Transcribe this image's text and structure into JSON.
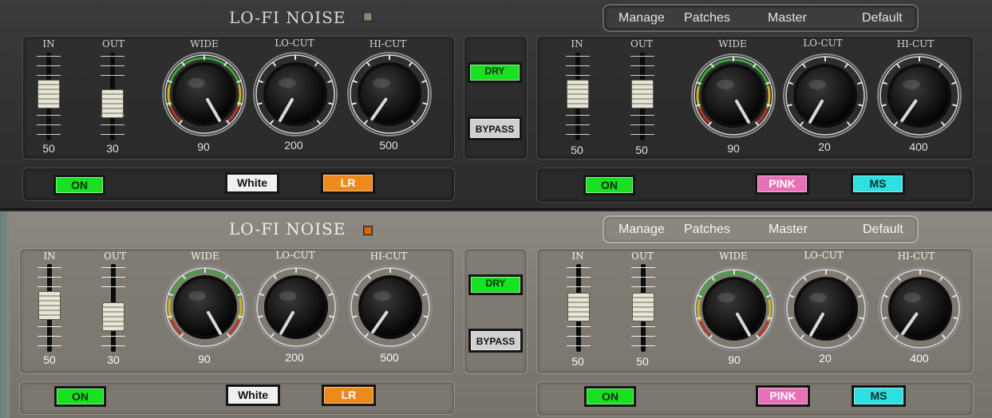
{
  "skins": [
    {
      "title": "LO-FI NOISE",
      "menu": [
        "Manage",
        "Patches",
        "Master",
        "Default"
      ],
      "left": {
        "faders": [
          {
            "label": "IN",
            "value": "50"
          },
          {
            "label": "OUT",
            "value": "30"
          }
        ],
        "knobs": [
          {
            "label": "WIDE",
            "value": "90"
          },
          {
            "label": "LO-CUT",
            "value": "200"
          },
          {
            "label": "HI-CUT",
            "value": "500"
          }
        ],
        "buttons": {
          "on": "ON",
          "noise": "White",
          "mode": "LR"
        }
      },
      "center": {
        "dry": "DRY",
        "bypass": "BYPASS"
      },
      "right": {
        "faders": [
          {
            "label": "IN",
            "value": "50"
          },
          {
            "label": "OUT",
            "value": "50"
          }
        ],
        "knobs": [
          {
            "label": "WIDE",
            "value": "90"
          },
          {
            "label": "LO-CUT",
            "value": "20"
          },
          {
            "label": "HI-CUT",
            "value": "400"
          }
        ],
        "buttons": {
          "on": "ON",
          "noise": "PINK",
          "mode": "MS"
        }
      }
    },
    {
      "title": "LO-FI NOISE",
      "menu": [
        "Manage",
        "Patches",
        "Master",
        "Default"
      ],
      "left": {
        "faders": [
          {
            "label": "IN",
            "value": "50"
          },
          {
            "label": "OUT",
            "value": "30"
          }
        ],
        "knobs": [
          {
            "label": "WIDE",
            "value": "90"
          },
          {
            "label": "LO-CUT",
            "value": "200"
          },
          {
            "label": "HI-CUT",
            "value": "500"
          }
        ],
        "buttons": {
          "on": "ON",
          "noise": "White",
          "mode": "LR"
        }
      },
      "center": {
        "dry": "DRY",
        "bypass": "BYPASS"
      },
      "right": {
        "faders": [
          {
            "label": "IN",
            "value": "50"
          },
          {
            "label": "OUT",
            "value": "50"
          }
        ],
        "knobs": [
          {
            "label": "WIDE",
            "value": "90"
          },
          {
            "label": "LO-CUT",
            "value": "20"
          },
          {
            "label": "HI-CUT",
            "value": "400"
          }
        ],
        "buttons": {
          "on": "ON",
          "noise": "PINK",
          "mode": "MS"
        }
      }
    }
  ],
  "colors": {
    "on_green": "#19e021",
    "lr_orange": "#ee8a1c",
    "pink": "#e870b6",
    "ms_cyan": "#2ee0e2",
    "knob_arc_green": "#3fa63a",
    "knob_arc_yellow": "#c9b22a",
    "knob_arc_red": "#b9332b"
  },
  "icons": {
    "power_led": "square-led",
    "knob": "rotary-knob",
    "fader": "slider-fader"
  }
}
